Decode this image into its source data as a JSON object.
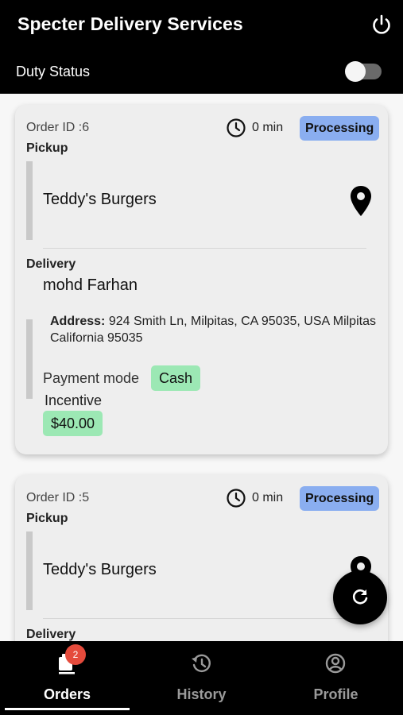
{
  "header": {
    "title": "Specter Delivery Services",
    "duty_status_label": "Duty Status",
    "duty_on": false
  },
  "orders": [
    {
      "order_id_label": "Order ID :6",
      "time": "0 min",
      "status": "Processing",
      "pickup_label": "Pickup",
      "restaurant": "Teddy's Burgers",
      "delivery_label": "Delivery",
      "customer": "mohd Farhan",
      "address_label": "Address:",
      "address_text": "924 Smith Ln, Milpitas, CA 95035, USA Milpitas California 95035",
      "payment_label": "Payment mode",
      "payment_value": "Cash",
      "incentive_label": "Incentive",
      "incentive_value": "$40.00"
    },
    {
      "order_id_label": "Order ID :5",
      "time": "0 min",
      "status": "Processing",
      "pickup_label": "Pickup",
      "restaurant": "Teddy's Burgers",
      "delivery_label": "Delivery"
    }
  ],
  "bottom_nav": {
    "items": [
      {
        "label": "Orders",
        "icon": "orders-icon",
        "badge": "2",
        "active": true
      },
      {
        "label": "History",
        "icon": "history-icon",
        "active": false
      },
      {
        "label": "Profile",
        "icon": "profile-icon",
        "active": false
      }
    ]
  },
  "colors": {
    "status_badge": "#8aaef0",
    "payment_badge": "#9ce8b4",
    "nav_badge": "#e54b3c"
  }
}
